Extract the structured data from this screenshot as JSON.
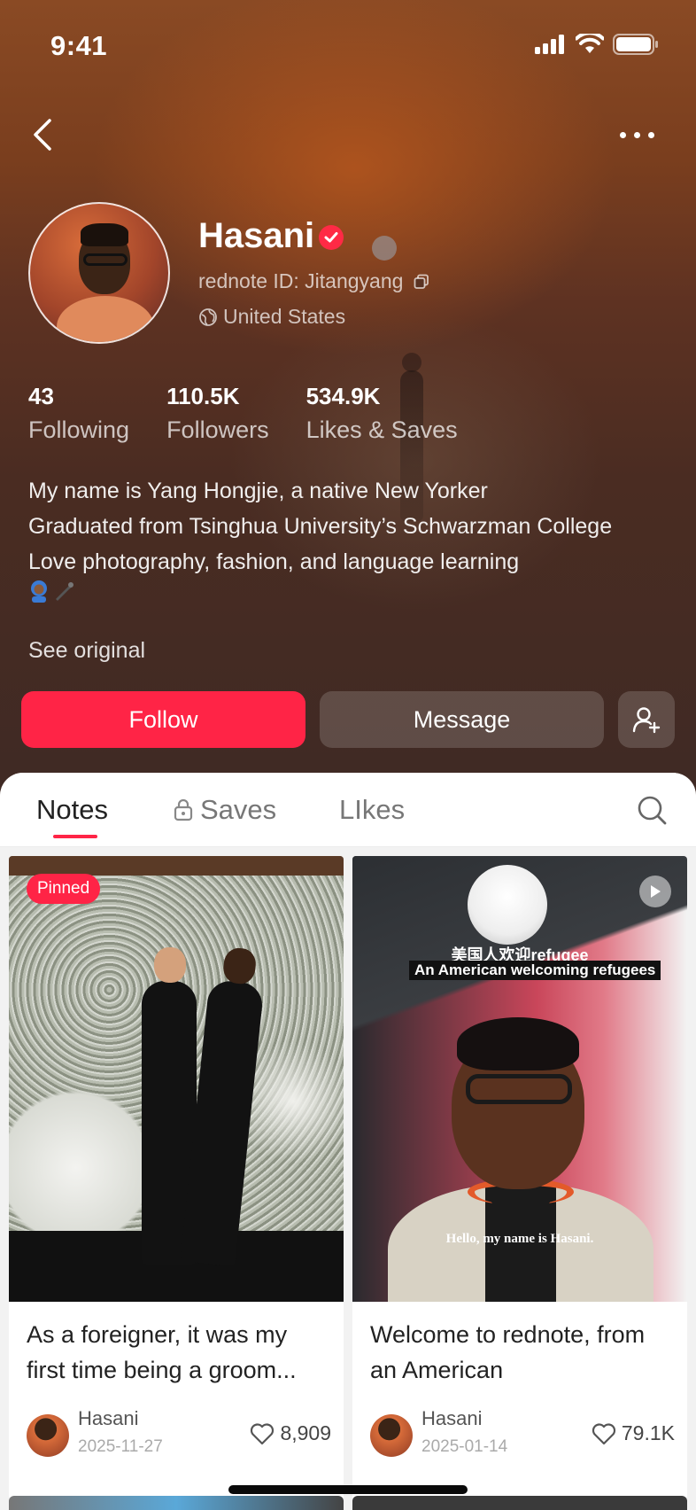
{
  "status_bar": {
    "time": "9:41"
  },
  "profile": {
    "name": "Hasani",
    "rednote_id": "rednote ID: Jitangyang",
    "location": "United States",
    "stats": [
      {
        "value": "43",
        "label": "Following"
      },
      {
        "value": "110.5K",
        "label": "Followers"
      },
      {
        "value": "534.9K",
        "label": "Likes & Saves"
      }
    ],
    "bio": [
      "My name is Yang Hongjie, a native New Yorker",
      "Graduated from Tsinghua University’s Schwarzman College",
      "Love photography, fashion, and language learning"
    ],
    "see_original": "See original"
  },
  "actions": {
    "follow": "Follow",
    "message": "Message"
  },
  "tabs": [
    {
      "label": "Notes"
    },
    {
      "label": "Saves"
    },
    {
      "label": "LIkes"
    }
  ],
  "notes": [
    {
      "badge": "Pinned",
      "title": "As a foreigner, it was my first time being a groom...",
      "author": "Hasani",
      "date": "2025-11-27",
      "likes": "8,909"
    },
    {
      "overlay_cn": "美国人欢迎refugee",
      "overlay_en": "An American welcoming refugees",
      "subtitle": "Hello, my name is Hasani.",
      "title": "Welcome to rednote, from an American",
      "author": "Hasani",
      "date": "2025-01-14",
      "likes": "79.1K"
    }
  ],
  "colors": {
    "accent": "#ff2446",
    "verified": "#ff2a45"
  },
  "icons": [
    "back-icon",
    "more-icon",
    "verified-icon",
    "copy-icon",
    "globe-icon",
    "add-friend-icon",
    "lock-icon",
    "search-icon",
    "play-icon",
    "heart-icon"
  ]
}
